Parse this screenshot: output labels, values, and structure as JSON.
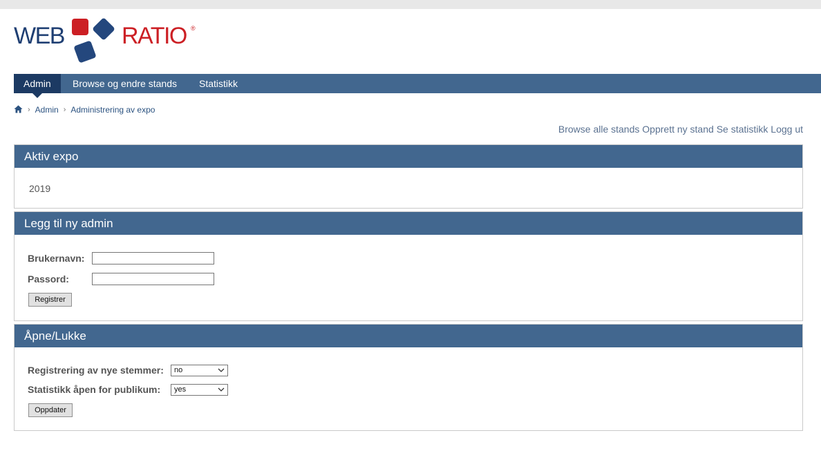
{
  "brand": {
    "left": "WEB",
    "right": "RATIO",
    "reg": "®"
  },
  "nav": {
    "items": [
      {
        "label": "Admin",
        "active": true
      },
      {
        "label": "Browse og endre stands",
        "active": false
      },
      {
        "label": "Statistikk",
        "active": false
      }
    ]
  },
  "breadcrumb": {
    "home_icon": "home-icon",
    "items": [
      "Admin",
      "Administrering av expo"
    ]
  },
  "toplinks": [
    "Browse alle stands",
    "Opprett ny stand",
    "Se statistikk",
    "Logg ut"
  ],
  "panels": {
    "aktiv": {
      "title": "Aktiv expo",
      "value": "2019"
    },
    "admin": {
      "title": "Legg til ny admin",
      "username_label": "Brukernavn:",
      "username_value": "",
      "password_label": "Passord:",
      "password_value": "",
      "submit": "Registrer"
    },
    "apne": {
      "title": "Åpne/Lukke",
      "reg_label": "Registrering av nye stemmer:",
      "reg_value": "no",
      "stat_label": "Statistikk åpen for publikum:",
      "stat_value": "yes",
      "submit": "Oppdater"
    }
  },
  "colors": {
    "nav_bg": "#42678f",
    "nav_active": "#1c3a63",
    "brand_blue": "#1f3f73",
    "brand_red": "#cc1f24"
  }
}
